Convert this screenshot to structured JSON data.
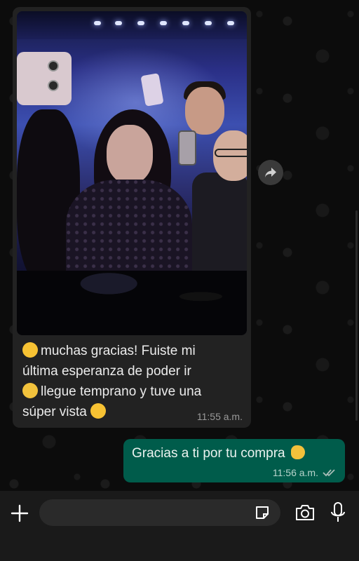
{
  "chat": {
    "incoming": {
      "image_alt": "concert photo",
      "text_line1": "muchas gracias! Fuiste mi",
      "text_line2": "última esperanza de poder ir",
      "text_line3": "llegue temprano y tuve una",
      "text_line4": "súper vista",
      "time": "11:55 a.m."
    },
    "outgoing": {
      "text": "Gracias a ti por tu compra",
      "time": "11:56 a.m.",
      "status": "read"
    }
  },
  "input_bar": {
    "placeholder": "",
    "icons": [
      "plus-icon",
      "sticker-icon",
      "camera-icon",
      "mic-icon"
    ]
  },
  "colors": {
    "incoming_bubble": "#222222",
    "outgoing_bubble": "#005c4b",
    "background": "#0c0c0c"
  }
}
